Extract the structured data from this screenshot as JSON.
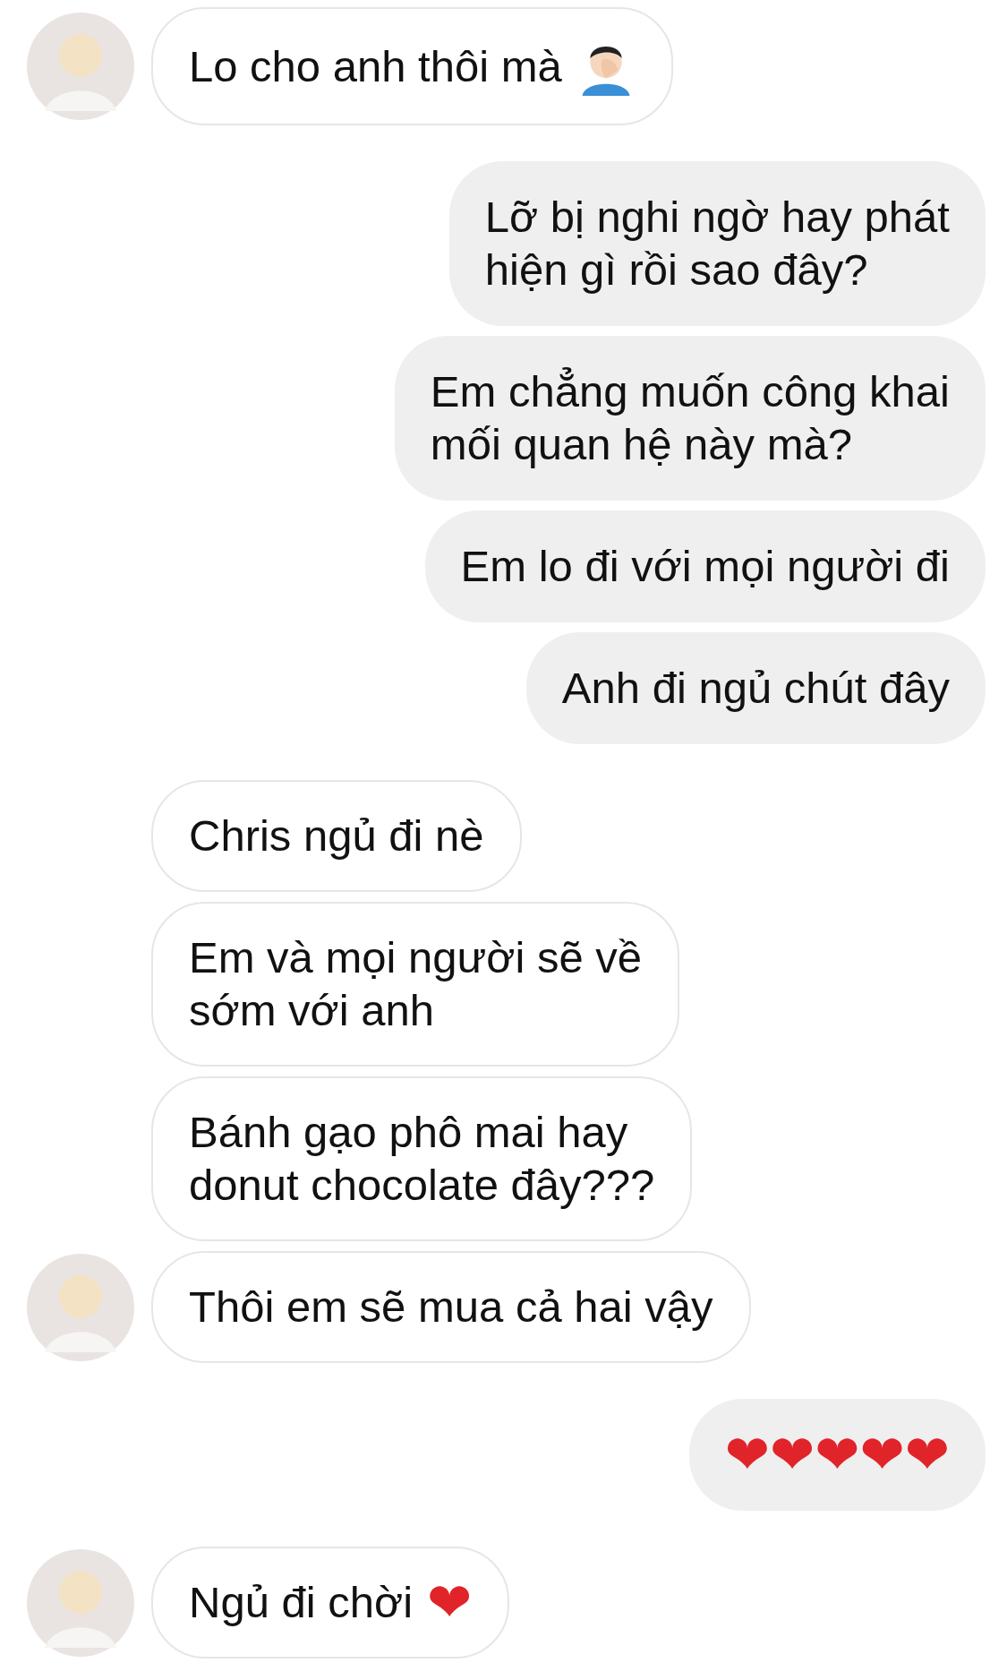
{
  "messages": [
    {
      "kind": "received",
      "avatar": true,
      "text": "Lo cho anh thôi mà",
      "emoji": {
        "kind": "facepalm"
      }
    },
    {
      "kind": "sent",
      "avatar": false,
      "text": "Lỡ bị nghi ngờ hay phát\nhiện gì rồi sao đây?"
    },
    {
      "kind": "sent",
      "avatar": false,
      "text": "Em chẳng muốn công khai\nmối quan hệ này mà?"
    },
    {
      "kind": "sent",
      "avatar": false,
      "text": "Em lo đi với mọi người đi"
    },
    {
      "kind": "sent",
      "avatar": false,
      "text": "Anh đi ngủ chút đây"
    },
    {
      "kind": "received",
      "avatar": false,
      "text": "Chris ngủ đi nè"
    },
    {
      "kind": "received",
      "avatar": false,
      "text": "Em và mọi người sẽ về\nsớm với anh"
    },
    {
      "kind": "received",
      "avatar": false,
      "text": "Bánh gạo phô mai hay\ndonut chocolate đây???"
    },
    {
      "kind": "received",
      "avatar": true,
      "text": "Thôi em sẽ mua cả hai vậy"
    },
    {
      "kind": "sent",
      "avatar": false,
      "emoji": {
        "kind": "char",
        "text": "❤❤❤❤❤"
      }
    },
    {
      "kind": "received",
      "avatar": true,
      "text": "Ngủ đi chời",
      "emoji": {
        "kind": "char",
        "text": "❤"
      }
    }
  ]
}
